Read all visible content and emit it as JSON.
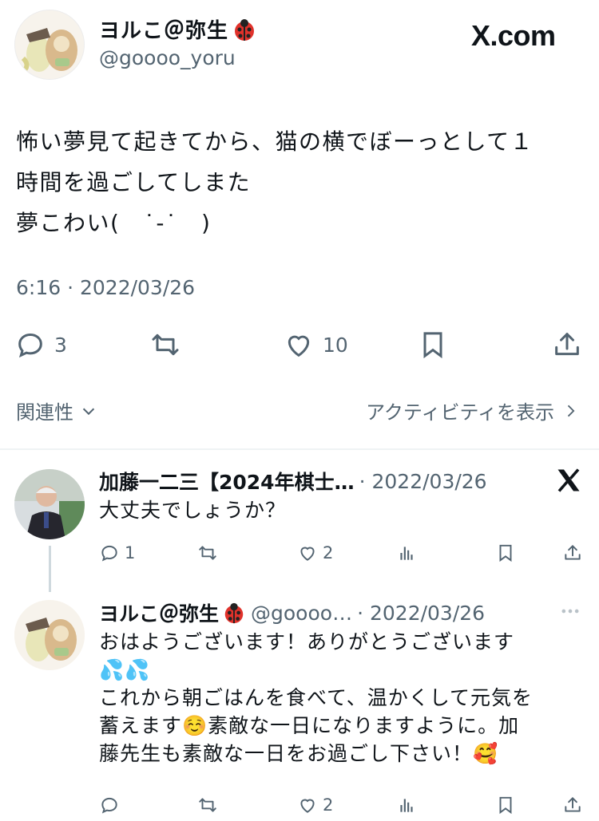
{
  "tweet": {
    "author_name": "ヨルこ＠弥生",
    "author_handle": "@goooo_yoru",
    "site_label": "X.com",
    "text_lines": [
      "怖い夢見て起きてから、猫の横でぼーっとして１",
      "時間を過ごしてしまた",
      "夢こわい(　˙-˙　)"
    ],
    "timestamp": "6:16 · 2022/03/26",
    "actions": {
      "replies": "3",
      "retweets": "",
      "likes": "10"
    },
    "sort_label": "関連性",
    "activity_label": "アクティビティを表示"
  },
  "replies": [
    {
      "author_name": "加藤一二三【2024年棋士…",
      "meta": "· 2022/03/26",
      "text_lines": [
        "大丈夫でしょうか？"
      ],
      "actions": {
        "replies": "1",
        "retweets": "",
        "likes": "2"
      }
    },
    {
      "author_name": "ヨルこ＠弥生",
      "handle": "@goooo…",
      "meta": "· 2022/03/26",
      "text_lines": [
        "おはようございます！ありがとうございます",
        "💦💦",
        "これから朝ごはんを食べて、温かくして元気を",
        "蓄えます☺️素敵な一日になりますように。加",
        "藤先生も素敵な一日をお過ごし下さい！🥰"
      ],
      "actions": {
        "replies": "",
        "retweets": "",
        "likes": "2"
      }
    }
  ],
  "colors": {
    "text": "#0f1419",
    "secondary": "#536471",
    "divider": "#e1e4e6"
  },
  "icons": [
    "ladybug-icon",
    "x-logo-icon",
    "reply-icon",
    "retweet-icon",
    "like-icon",
    "bookmark-icon",
    "share-icon",
    "chevron-down-icon",
    "chevron-right-icon",
    "views-icon",
    "more-icon"
  ]
}
